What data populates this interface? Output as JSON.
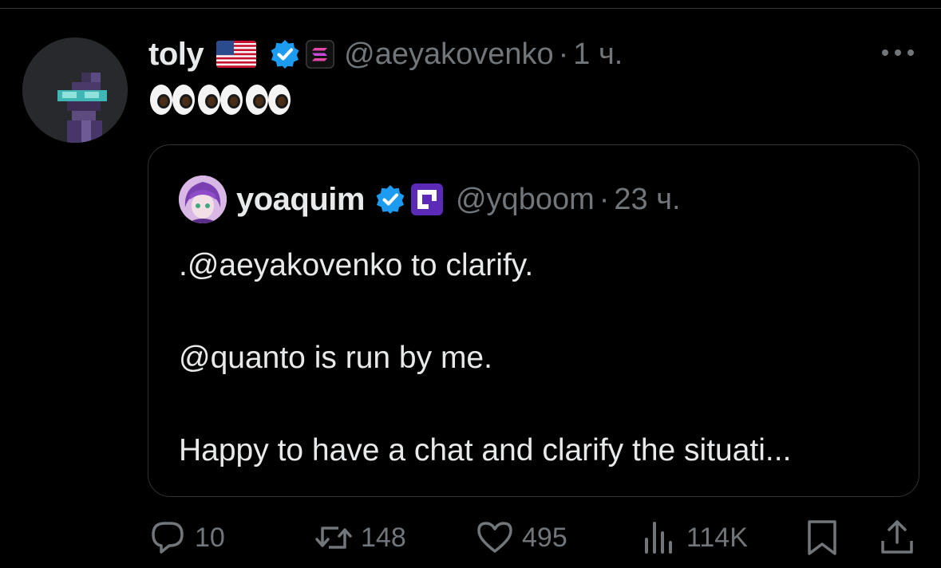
{
  "tweet": {
    "author_name": "toly",
    "author_flag": "us-flag-icon",
    "author_handle": "@aeyakovenko",
    "separator": "·",
    "time": "1 ч.",
    "text": "👀👀👀"
  },
  "quote": {
    "author_name": "yoaquim",
    "author_handle": "@yqboom",
    "separator": "·",
    "time": "23 ч.",
    "lines": [
      ".@aeyakovenko to clarify.",
      "@quanto is run by me.",
      "Happy to have a chat and clarify the situati..."
    ]
  },
  "actions": {
    "replies": "10",
    "reposts": "148",
    "likes": "495",
    "views": "114K"
  },
  "colors": {
    "background": "#000000",
    "text": "#e7e9ea",
    "muted": "#71767b",
    "verified": "#1d9bf0",
    "border": "#2f3336"
  }
}
